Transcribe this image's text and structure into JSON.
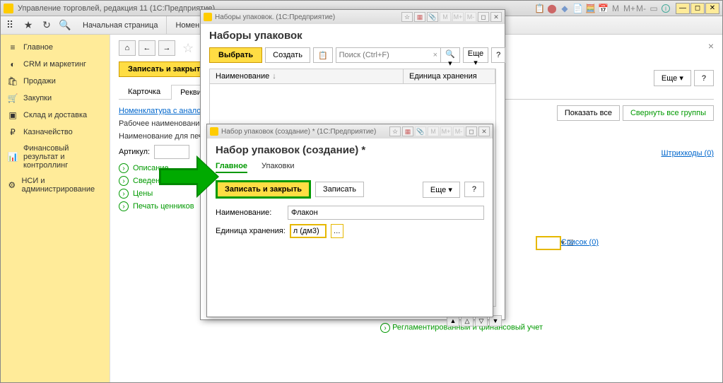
{
  "app": {
    "title": "Управление торговлей, редакция 11 (1С:Предприятие)"
  },
  "tabs": {
    "home": "Начальная страница",
    "nomenclature": "Номенклат..."
  },
  "sidebar": {
    "items": [
      {
        "icon": "≡",
        "label": "Главное"
      },
      {
        "icon": "◐",
        "label": "CRM и маркетинг"
      },
      {
        "icon": "🛍",
        "label": "Продажи"
      },
      {
        "icon": "🛒",
        "label": "Закупки"
      },
      {
        "icon": "📦",
        "label": "Склад и доставка"
      },
      {
        "icon": "₽",
        "label": "Казначейство"
      },
      {
        "icon": "📊",
        "label": "Финансовый результат и контроллинг"
      },
      {
        "icon": "⚙",
        "label": "НСИ и администрирование"
      }
    ]
  },
  "content": {
    "save_close": "Записать и закрыть",
    "tab_card": "Карточка",
    "tab_req": "Реквизиты",
    "analog_link": "Номенклатура с аналоги",
    "work_name_label": "Рабочее наименование:",
    "print_name_label": "Наименование для печат",
    "article_label": "Артикул:",
    "expand_desc": "Описание",
    "expand_info": "Сведения о прои",
    "expand_prices": "Цены",
    "expand_print": "Печать ценников",
    "more_btn": "Еще",
    "show_all": "Показать все",
    "collapse_all": "Свернуть все группы",
    "barcodes": "Штрихкоды (0)",
    "list_label": "Список (0)",
    "bottom_link": "Регламентированный и финансовый учет"
  },
  "dialog1": {
    "window_title": "Наборы упаковок. (1С:Предприятие)",
    "title": "Наборы упаковок",
    "select_btn": "Выбрать",
    "create_btn": "Создать",
    "search_placeholder": "Поиск (Ctrl+F)",
    "more_btn": "Еще",
    "col_name": "Наименование",
    "col_unit": "Единица хранения"
  },
  "dialog2": {
    "window_title": "Набор упаковок (создание) * (1С:Предприятие)",
    "title": "Набор упаковок (создание) *",
    "tab_main": "Главное",
    "tab_pack": "Упаковки",
    "save_close": "Записать и закрыть",
    "save": "Записать",
    "more_btn": "Еще",
    "name_label": "Наименование:",
    "name_value": "Флакон",
    "unit_label": "Единица хранения:",
    "unit_value": "л (дм3)"
  }
}
